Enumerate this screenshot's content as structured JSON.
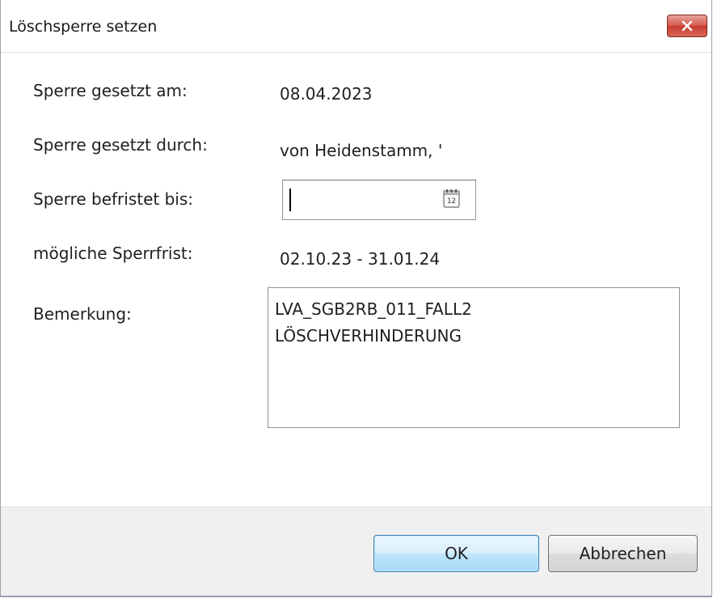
{
  "window": {
    "title": "Löschsperre setzen",
    "close_icon": "close-icon"
  },
  "fields": {
    "set_on_label": "Sperre gesetzt am:",
    "set_on_value": "08.04.2023",
    "set_by_label": "Sperre gesetzt durch:",
    "set_by_value": "von Heidenstamm, '",
    "limited_until_label": "Sperre befristet bis:",
    "limited_until_value": "",
    "calendar_icon": "calendar-icon",
    "calendar_day": "12",
    "period_label": "mögliche Sperrfrist:",
    "period_value": "02.10.23 - 31.01.24",
    "remark_label": "Bemerkung:",
    "remark_lines": [
      "LVA_SGB2RB_011_FALL2",
      "LÖSCHVERHINDERUNG"
    ]
  },
  "buttons": {
    "ok": "OK",
    "cancel": "Abbrechen"
  },
  "colors": {
    "close_button": "#c63b2e",
    "default_button": "#bee6fd",
    "footer": "#f0f0f0"
  }
}
